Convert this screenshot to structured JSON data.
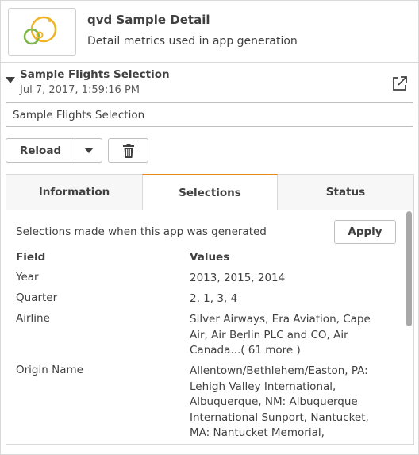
{
  "app": {
    "title": "qvd Sample Detail",
    "description": "Detail metrics used in app generation"
  },
  "bookmark": {
    "title": "Sample Flights Selection",
    "date": "Jul 7, 2017, 1:59:16 PM",
    "name_value": "Sample Flights Selection"
  },
  "actions": {
    "reload_label": "Reload"
  },
  "tabs": [
    {
      "label": "Information",
      "active": false
    },
    {
      "label": "Selections",
      "active": true
    },
    {
      "label": "Status",
      "active": false
    }
  ],
  "selections": {
    "description": "Selections made when this app was generated",
    "apply_label": "Apply",
    "field_header": "Field",
    "values_header": "Values",
    "rows": [
      {
        "field": "Year",
        "values": "2013, 2015, 2014"
      },
      {
        "field": "Quarter",
        "values": "2, 1, 3, 4"
      },
      {
        "field": "Airline",
        "values": "Silver Airways, Era Aviation, Cape Air, Air Berlin PLC and CO, Air Canada...( 61 more )"
      },
      {
        "field": "Origin Name",
        "values": "Allentown/Bethlehem/Easton, PA: Lehigh Valley International, Albuquerque, NM: Albuquerque International Sunport, Nantucket, MA: Nantucket Memorial, Arcata/Eureka,"
      }
    ]
  },
  "colors": {
    "accent_tab": "#e88a1a",
    "logo_yellow": "#f0b323",
    "logo_green": "#7ab648"
  },
  "icons": {
    "open_external": "open-external-icon",
    "delete": "trash-icon",
    "expand": "caret-down-icon",
    "dropdown": "chevron-down-icon"
  }
}
